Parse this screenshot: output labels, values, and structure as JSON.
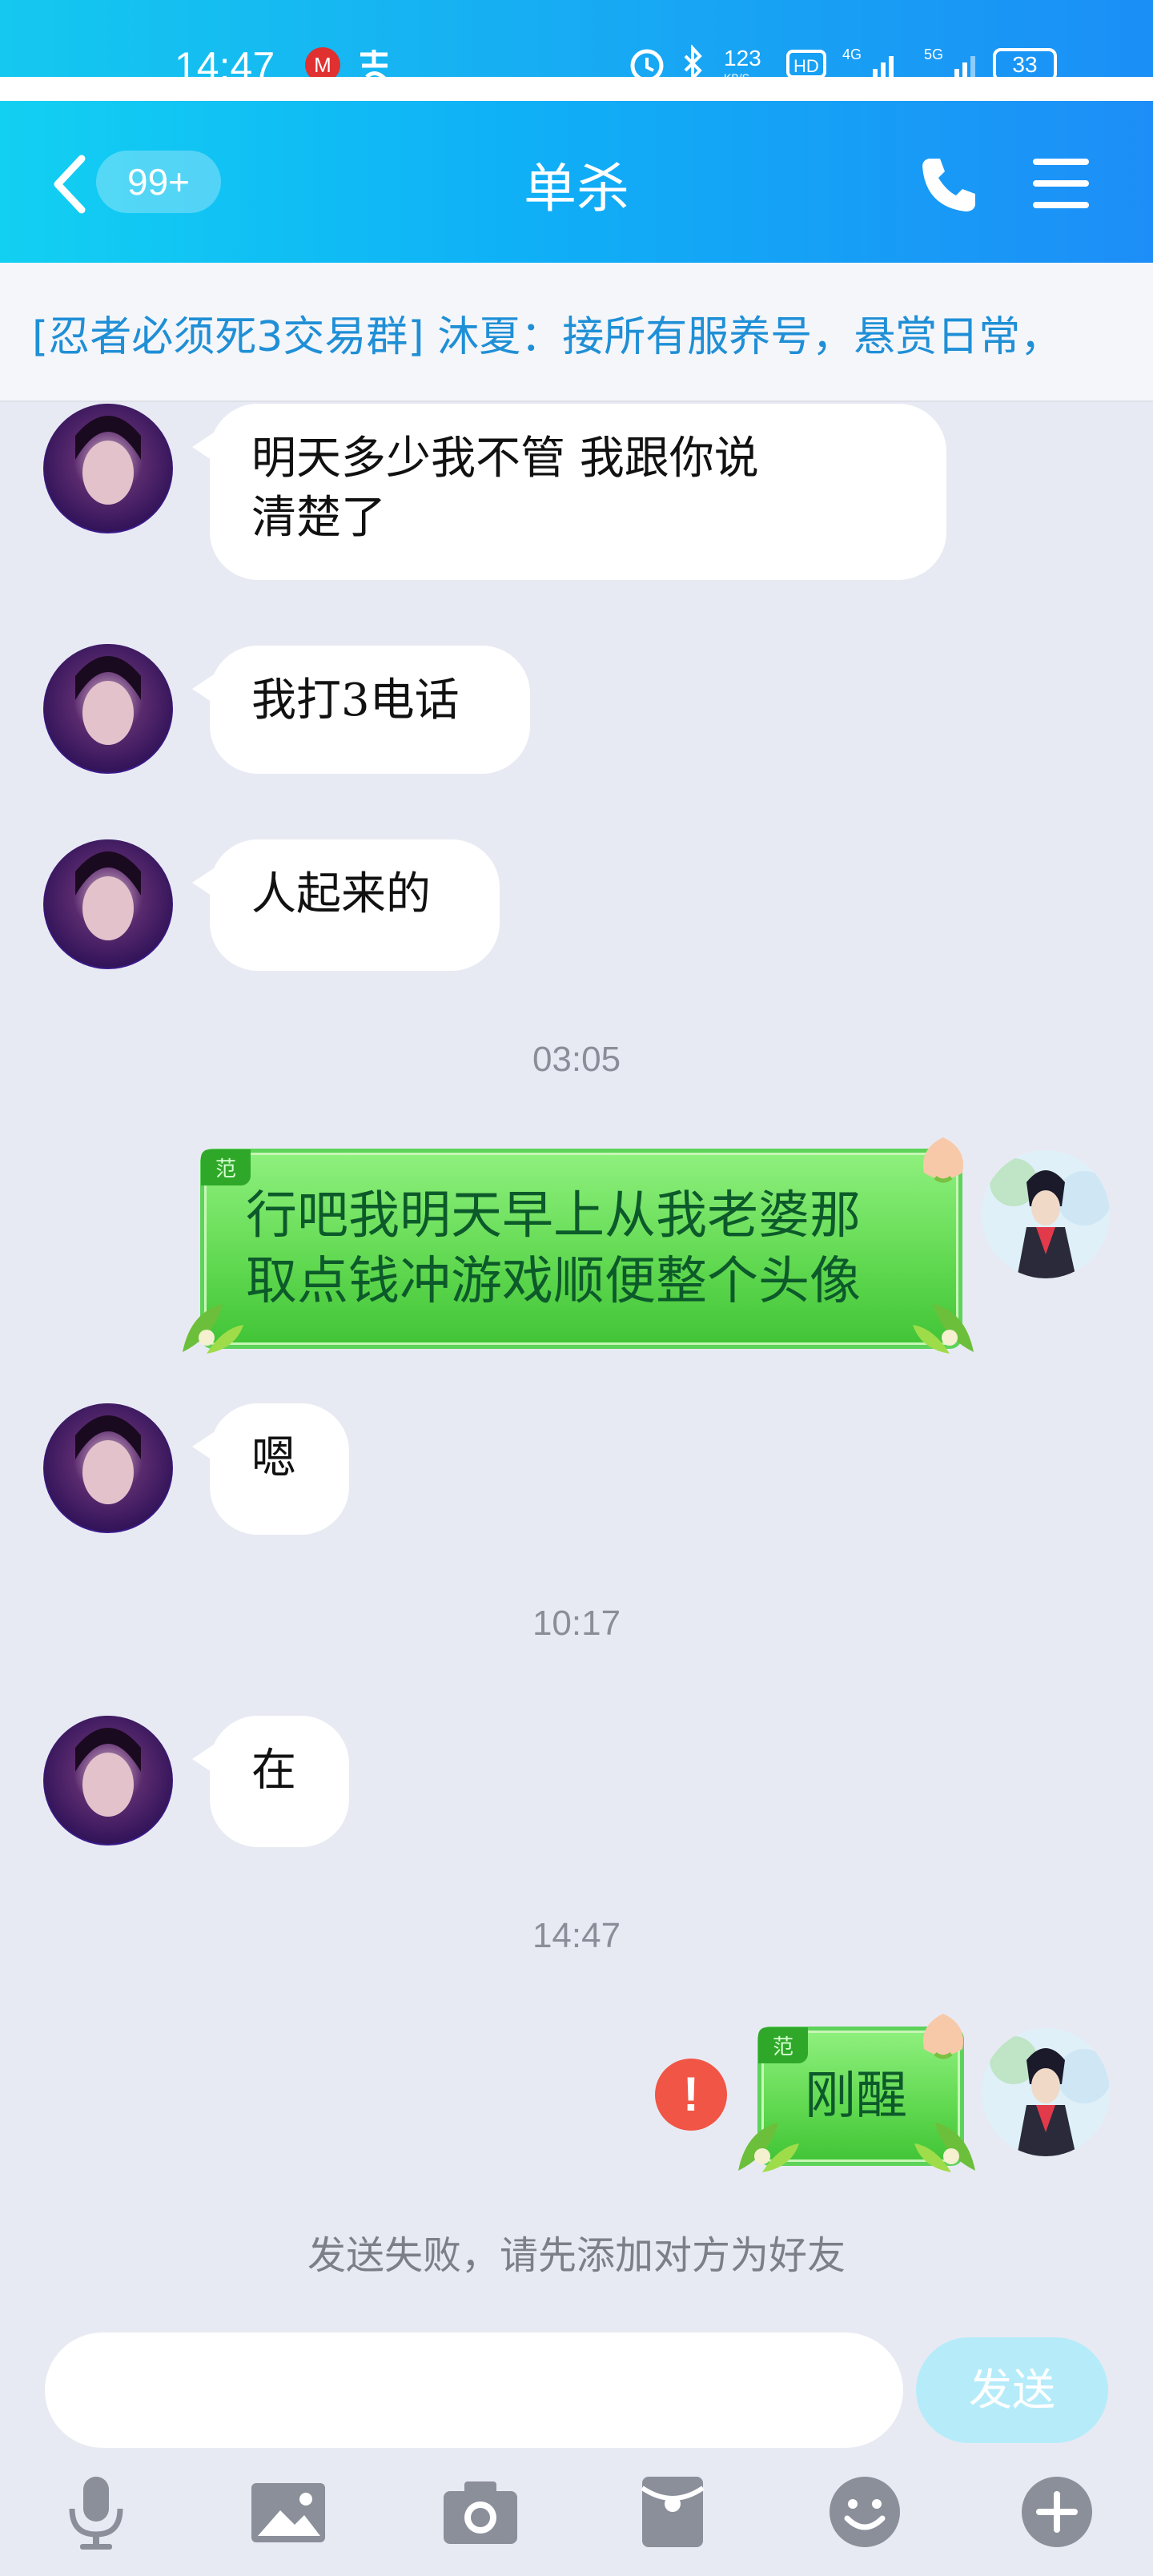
{
  "status_bar": {
    "time": "14:47",
    "battery": "33"
  },
  "header": {
    "unread_badge": "99+",
    "title": "单杀"
  },
  "notice_bar": {
    "text": "[忍者必须死3交易群] 沐夏：接所有服养号，悬赏日常，"
  },
  "messages": [
    {
      "side": "left",
      "text_lines": [
        "明天多少我不管 我跟你说",
        "清楚了"
      ]
    },
    {
      "side": "left",
      "text": "我打3电话"
    },
    {
      "side": "left",
      "text": "人起来的"
    },
    {
      "type": "timestamp",
      "text": "03:05"
    },
    {
      "side": "right",
      "tag": "范",
      "text_lines": [
        "行吧我明天早上从我老婆那",
        "取点钱冲游戏顺便整个头像"
      ]
    },
    {
      "side": "left",
      "text": "嗯"
    },
    {
      "type": "timestamp",
      "text": "10:17"
    },
    {
      "side": "left",
      "text": "在"
    },
    {
      "type": "timestamp",
      "text": "14:47"
    },
    {
      "side": "right",
      "tag": "范",
      "text": "刚醒",
      "failed": true
    }
  ],
  "system_notice": "发送失败，请先添加对方为好友",
  "composer": {
    "input_value": "",
    "send_label": "发送"
  },
  "toolbar": {
    "icons": [
      "microphone-icon",
      "image-icon",
      "camera-icon",
      "red-packet-icon",
      "emoji-icon",
      "plus-icon"
    ]
  },
  "colors": {
    "header_start": "#12d0f2",
    "header_end": "#1d8ef7",
    "notice_text": "#1f8fd6",
    "send_button": "#b6ecfa",
    "fail_red": "#f05545",
    "chat_bg": "#e8eaf3"
  }
}
